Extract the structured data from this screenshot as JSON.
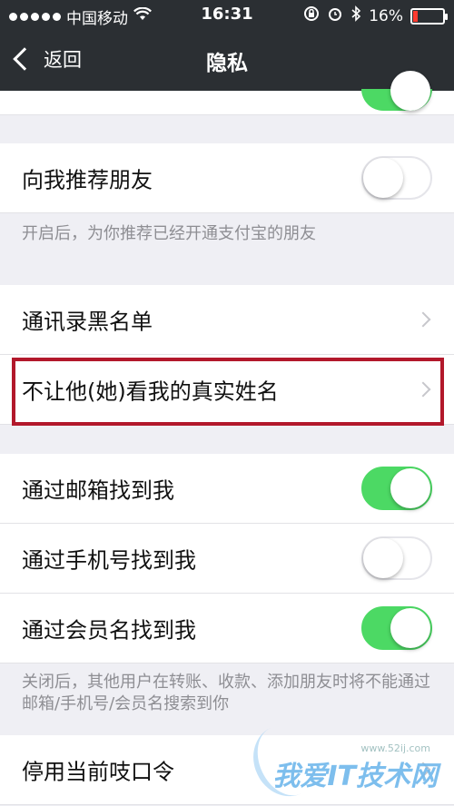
{
  "status_bar": {
    "carrier": "中国移动",
    "time": "16:31",
    "battery_percent": "16%",
    "battery_level": 0.16,
    "battery_color": "#ff3b30"
  },
  "nav": {
    "back_label": "返回",
    "title": "隐私"
  },
  "sections": {
    "recommend": {
      "label": "向我推荐朋友",
      "enabled": false,
      "caption": "开启后，为你推荐已经开通支付宝的朋友"
    },
    "blacklist": {
      "label": "通讯录黑名单"
    },
    "hide_name": {
      "label": "不让他(她)看我的真实姓名"
    },
    "find_email": {
      "label": "通过邮箱找到我",
      "enabled": true
    },
    "find_phone": {
      "label": "通过手机号找到我",
      "enabled": false
    },
    "find_member": {
      "label": "通过会员名找到我",
      "enabled": true
    },
    "find_caption": "关闭后，其他用户在转账、收款、添加朋友时将不能通过邮箱/手机号/会员名搜索到你",
    "disable_code": {
      "label": "停用当前吱口令"
    }
  },
  "colors": {
    "nav_bg": "#2b2f33",
    "toggle_on": "#4cd964",
    "highlight_border": "#b2182b"
  },
  "watermark": {
    "text": "我爱IT技术网",
    "url": "www.52ij.com"
  }
}
